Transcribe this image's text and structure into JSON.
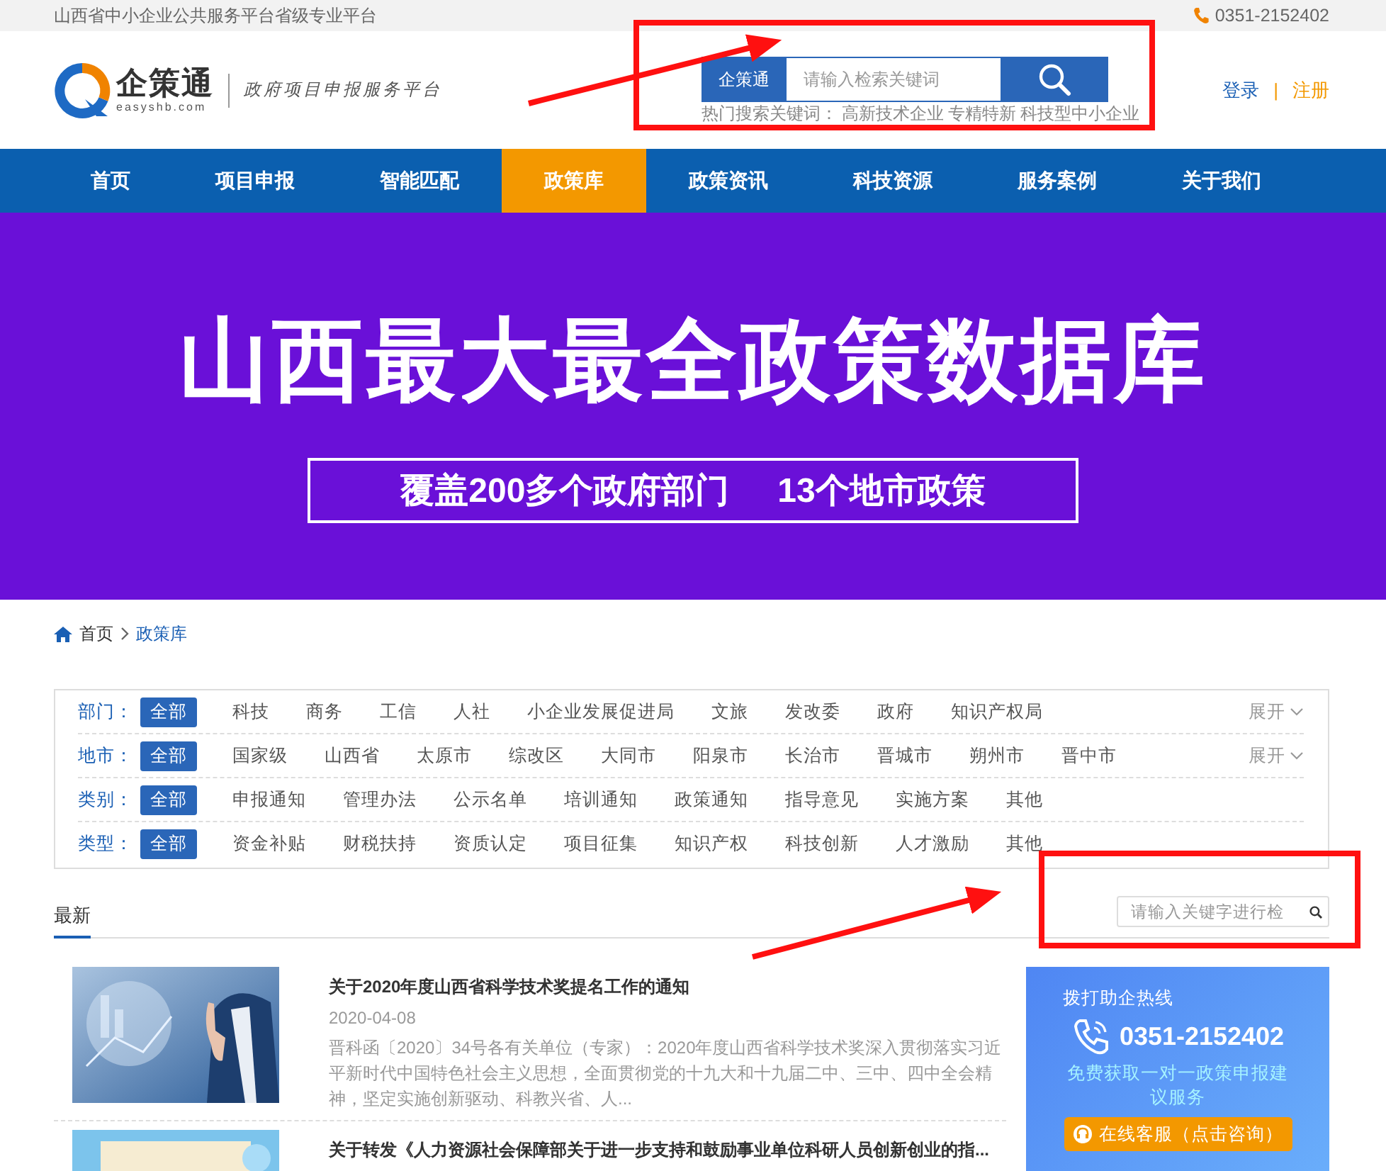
{
  "top_bar": {
    "slogan": "山西省中小企业公共服务平台省级专业平台",
    "phone": "0351-2152402"
  },
  "header": {
    "logo": {
      "name": "企策通",
      "domain": "easyshb.com"
    },
    "tagline": "政府项目申报服务平台",
    "search": {
      "scope": "企策通",
      "placeholder": "请输入检索关键词"
    },
    "hot_keywords": {
      "label": "热门搜索关键词：",
      "items": [
        "高新技术企业",
        "专精特新",
        "科技型中小企业"
      ]
    },
    "login": "登录",
    "separator": "|",
    "register": "注册"
  },
  "nav": [
    {
      "label": "首页",
      "selected": false
    },
    {
      "label": "项目申报",
      "selected": false
    },
    {
      "label": "智能匹配",
      "selected": false
    },
    {
      "label": "政策库",
      "selected": true
    },
    {
      "label": "政策资讯",
      "selected": false
    },
    {
      "label": "科技资源",
      "selected": false
    },
    {
      "label": "服务案例",
      "selected": false
    },
    {
      "label": "关于我们",
      "selected": false
    }
  ],
  "banner": {
    "headline": "山西最大最全政策数据库",
    "subtitle": [
      "覆盖200多个政府部门",
      "13个地市政策"
    ]
  },
  "breadcrumb": [
    "首页",
    "政策库"
  ],
  "filters": [
    {
      "label": "部门：",
      "expand": "展开",
      "options": [
        {
          "label": "全部",
          "selected": true
        },
        {
          "label": "科技",
          "selected": false
        },
        {
          "label": "商务",
          "selected": false
        },
        {
          "label": "工信",
          "selected": false
        },
        {
          "label": "人社",
          "selected": false
        },
        {
          "label": "小企业发展促进局",
          "selected": false
        },
        {
          "label": "文旅",
          "selected": false
        },
        {
          "label": "发改委",
          "selected": false
        },
        {
          "label": "政府",
          "selected": false
        },
        {
          "label": "知识产权局",
          "selected": false
        }
      ]
    },
    {
      "label": "地市：",
      "expand": "展开",
      "options": [
        {
          "label": "全部",
          "selected": true
        },
        {
          "label": "国家级",
          "selected": false
        },
        {
          "label": "山西省",
          "selected": false
        },
        {
          "label": "太原市",
          "selected": false
        },
        {
          "label": "综改区",
          "selected": false
        },
        {
          "label": "大同市",
          "selected": false
        },
        {
          "label": "阳泉市",
          "selected": false
        },
        {
          "label": "长治市",
          "selected": false
        },
        {
          "label": "晋城市",
          "selected": false
        },
        {
          "label": "朔州市",
          "selected": false
        },
        {
          "label": "晋中市",
          "selected": false
        }
      ]
    },
    {
      "label": "类别：",
      "options": [
        {
          "label": "全部",
          "selected": true
        },
        {
          "label": "申报通知",
          "selected": false
        },
        {
          "label": "管理办法",
          "selected": false
        },
        {
          "label": "公示名单",
          "selected": false
        },
        {
          "label": "培训通知",
          "selected": false
        },
        {
          "label": "政策通知",
          "selected": false
        },
        {
          "label": "指导意见",
          "selected": false
        },
        {
          "label": "实施方案",
          "selected": false
        },
        {
          "label": "其他",
          "selected": false
        }
      ]
    },
    {
      "label": "类型：",
      "options": [
        {
          "label": "全部",
          "selected": true
        },
        {
          "label": "资金补贴",
          "selected": false
        },
        {
          "label": "财税扶持",
          "selected": false
        },
        {
          "label": "资质认定",
          "selected": false
        },
        {
          "label": "项目征集",
          "selected": false
        },
        {
          "label": "知识产权",
          "selected": false
        },
        {
          "label": "科技创新",
          "selected": false
        },
        {
          "label": "人才激励",
          "selected": false
        },
        {
          "label": "其他",
          "selected": false
        }
      ]
    }
  ],
  "list_tabs": [
    {
      "label": "最新",
      "selected": true
    }
  ],
  "list_search": {
    "placeholder": "请输入关键字进行检"
  },
  "articles": [
    {
      "kind": "picture",
      "title": "关于2020年度山西省科学技术奖提名工作的通知",
      "date": "2020-04-08",
      "summary": "晋科函〔2020〕34号各有关单位（专家）：2020年度山西省科学技术奖深入贯彻落实习近平新时代中国特色社会主义思想，全面贯彻党的十九大和十九届二中、三中、四中全会精神，坚定实施创新驱动、科教兴省、人..."
    },
    {
      "kind": "picture",
      "title": "关于转发《人力资源社会保障部关于进一步支持和鼓励事业单位科研人员创新创业的指..."
    }
  ],
  "hotline": {
    "title": "拨打助企热线",
    "phone": "0351-2152402",
    "note": "免费获取一对一政策申报建议服务",
    "button": "在线客服（点击咨询）"
  }
}
